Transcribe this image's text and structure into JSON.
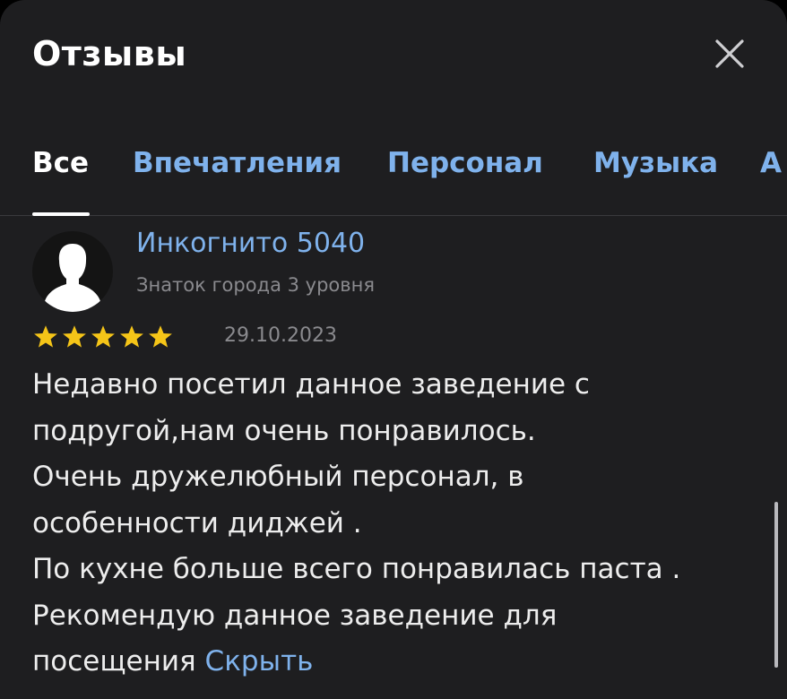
{
  "header": {
    "title": "Отзывы",
    "close_icon": "close-icon"
  },
  "tabs": [
    {
      "label": "Все",
      "active": true
    },
    {
      "label": "Впечатления",
      "active": false
    },
    {
      "label": "Персонал",
      "active": false
    },
    {
      "label": "Музыка",
      "active": false
    },
    {
      "label": "А",
      "active": false
    }
  ],
  "review": {
    "author": "Инкогнито 5040",
    "author_level": "Знаток города 3 уровня",
    "rating": 5,
    "rating_max": 5,
    "date": "29.10.2023",
    "text_lines": [
      "Недавно посетил данное заведение с",
      "подругой,нам очень понравилось.",
      "Очень дружелюбный персонал, в",
      "особенности диджей .",
      "По кухне больше всего понравилась паста .",
      "Рекомендую данное заведение для",
      "посещения"
    ],
    "hide_label": "Скрыть"
  },
  "colors": {
    "background": "#1e1e20",
    "accent": "#7fb2ec",
    "star": "#f5c518",
    "text": "#ededed",
    "muted": "#8a8a8e"
  }
}
